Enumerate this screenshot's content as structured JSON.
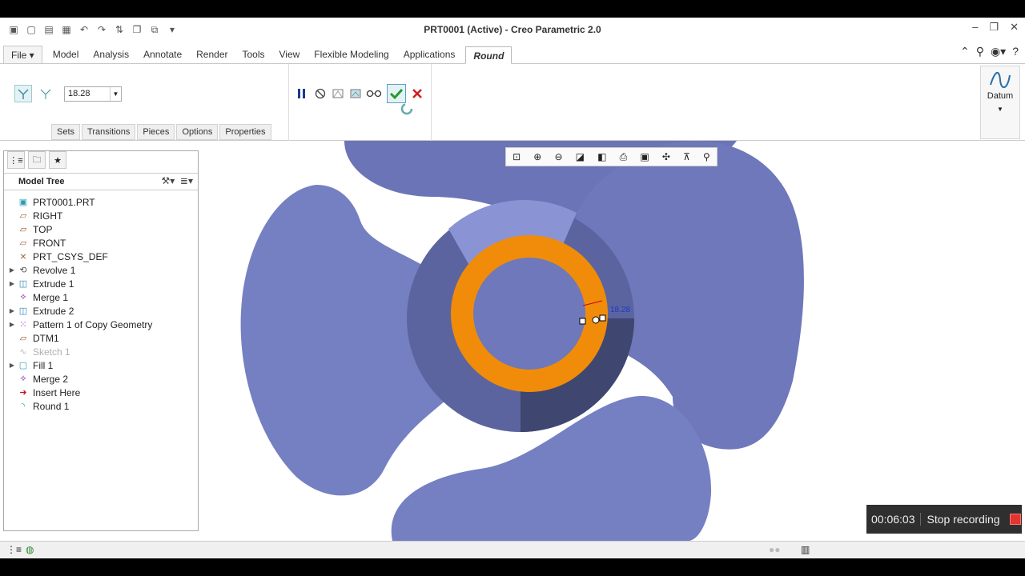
{
  "window": {
    "title": "PRT0001 (Active) - Creo Parametric 2.0"
  },
  "ribbon": {
    "tabs": [
      {
        "label": "File ▾"
      },
      {
        "label": "Model"
      },
      {
        "label": "Analysis"
      },
      {
        "label": "Annotate"
      },
      {
        "label": "Render"
      },
      {
        "label": "Tools"
      },
      {
        "label": "View"
      },
      {
        "label": "Flexible Modeling"
      },
      {
        "label": "Applications"
      },
      {
        "label": "Round"
      }
    ],
    "radius_value": "18.28",
    "subtabs": [
      "Sets",
      "Transitions",
      "Pieces",
      "Options",
      "Properties"
    ],
    "datum_label": "Datum"
  },
  "model_tree": {
    "header": "Model Tree",
    "nodes": [
      {
        "label": "PRT0001.PRT",
        "icon": "part-icon",
        "expandable": false,
        "dim": false
      },
      {
        "label": "RIGHT",
        "icon": "datum-plane-icon",
        "expandable": false,
        "dim": false
      },
      {
        "label": "TOP",
        "icon": "datum-plane-icon",
        "expandable": false,
        "dim": false
      },
      {
        "label": "FRONT",
        "icon": "datum-plane-icon",
        "expandable": false,
        "dim": false
      },
      {
        "label": "PRT_CSYS_DEF",
        "icon": "csys-icon",
        "expandable": false,
        "dim": false
      },
      {
        "label": "Revolve 1",
        "icon": "revolve-icon",
        "expandable": true,
        "dim": false
      },
      {
        "label": "Extrude 1",
        "icon": "extrude-icon",
        "expandable": true,
        "dim": false
      },
      {
        "label": "Merge 1",
        "icon": "merge-icon",
        "expandable": false,
        "dim": false
      },
      {
        "label": "Extrude 2",
        "icon": "extrude-icon",
        "expandable": true,
        "dim": false
      },
      {
        "label": "Pattern 1 of Copy Geometry",
        "icon": "pattern-icon",
        "expandable": true,
        "dim": false
      },
      {
        "label": "DTM1",
        "icon": "datum-plane-icon",
        "expandable": false,
        "dim": false
      },
      {
        "label": "Sketch 1",
        "icon": "sketch-icon",
        "expandable": false,
        "dim": true
      },
      {
        "label": "Fill 1",
        "icon": "fill-icon",
        "expandable": true,
        "dim": false
      },
      {
        "label": "Merge 2",
        "icon": "merge-icon",
        "expandable": false,
        "dim": false
      },
      {
        "label": "Insert Here",
        "icon": "insert-arrow-icon",
        "expandable": false,
        "dim": false
      },
      {
        "label": "Round 1",
        "icon": "round-icon",
        "expandable": false,
        "dim": false
      }
    ]
  },
  "viewport": {
    "dimension_label": "18.28"
  },
  "recording": {
    "time": "00:06:03",
    "stop_label": "Stop recording"
  },
  "colors": {
    "blade": "#7580c2",
    "hub_dark": "#3f4670",
    "round_highlight": "#f08c0a",
    "accept": "#1f9c2f",
    "cancel": "#d21f1f"
  }
}
